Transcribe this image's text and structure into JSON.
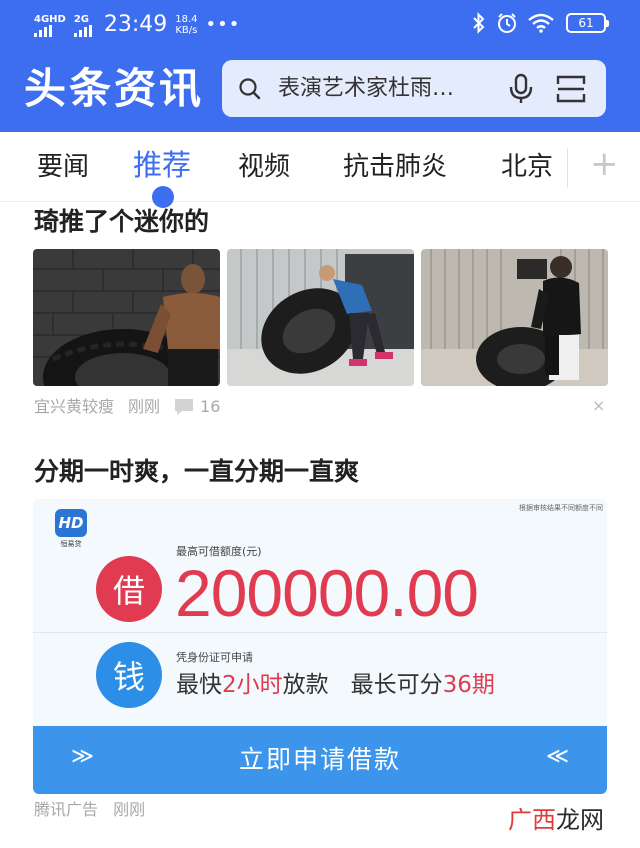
{
  "status_bar": {
    "network1": "4GHD",
    "network2": "2G",
    "time": "23:49",
    "speed_value": "18.4",
    "speed_unit": "KB/s",
    "more": "•••",
    "battery": "61"
  },
  "header": {
    "app_title": "头条资讯",
    "search_text": "表演艺术家杜雨…"
  },
  "tabs": [
    {
      "label": "要闻"
    },
    {
      "label": "推荐"
    },
    {
      "label": "视频"
    },
    {
      "label": "抗击肺炎"
    },
    {
      "label": "北京"
    }
  ],
  "tabs_add": "+",
  "feed": {
    "article": {
      "title": "琦推了个迷你的",
      "source": "宜兴黄较瘦",
      "time": "刚刚",
      "comments": "16",
      "close": "×",
      "images": [
        {
          "icon": "photo-muscular-man-with-tire"
        },
        {
          "icon": "photo-man-flipping-tire"
        },
        {
          "icon": "photo-man-pushing-tire"
        }
      ]
    },
    "ad": {
      "title": "分期一时爽，一直分期一直爽",
      "note": "根据审核结果不同额度不同",
      "logo_text": "HD",
      "logo_name": "恒易贷",
      "borrow_char": "借",
      "amount_label": "最高可借额度(元)",
      "amount": "200000.00",
      "money_char": "钱",
      "condition": "凭身份证可申请",
      "line_a": "最快",
      "line_b": "2小时",
      "line_c": "放款",
      "line_d": "最长可分",
      "line_e": "36期",
      "button_label": "立即申请借款",
      "arrow_left": "≫",
      "arrow_right": "≪",
      "source": "腾讯广告",
      "time": "刚刚"
    }
  },
  "watermark": {
    "part1": "广西",
    "part2": "龙网"
  },
  "colors": {
    "header_blue": "#3d6ef0",
    "accent_red": "#e03b50",
    "button_blue": "#3c95ea"
  }
}
